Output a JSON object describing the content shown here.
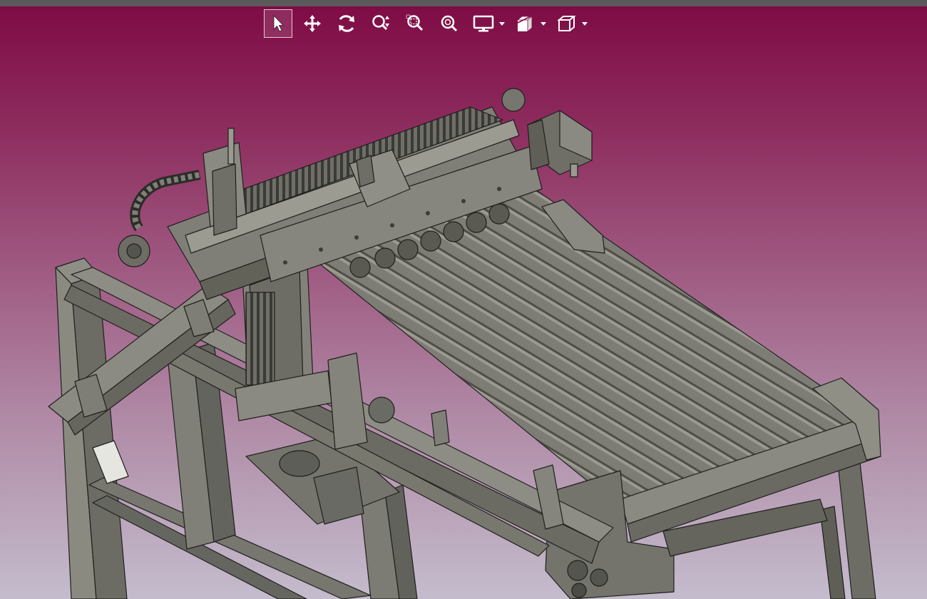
{
  "app": {
    "accent_color": "#7e0a44",
    "toolbar_icon_color": "#ffffff"
  },
  "toolbar": {
    "tools": [
      {
        "id": "select",
        "icon": "arrow-pointer-icon",
        "active": true
      },
      {
        "id": "pan",
        "icon": "move-arrows-icon",
        "active": false
      },
      {
        "id": "rotate",
        "icon": "rotate-icon",
        "active": false
      },
      {
        "id": "zoom",
        "icon": "zoom-updown-icon",
        "active": false
      },
      {
        "id": "zoom-window",
        "icon": "zoom-window-icon",
        "active": false
      },
      {
        "id": "zoom-fit",
        "icon": "zoom-fit-icon",
        "active": false
      }
    ],
    "dropdowns": [
      {
        "id": "display-mode",
        "icon": "monitor-icon"
      },
      {
        "id": "section-views",
        "icon": "section-icon"
      },
      {
        "id": "standard-views",
        "icon": "cube-icon"
      }
    ]
  },
  "model": {
    "name_shown": "",
    "body_color": "#7b7b73",
    "edge_color": "#1f1f1c"
  }
}
